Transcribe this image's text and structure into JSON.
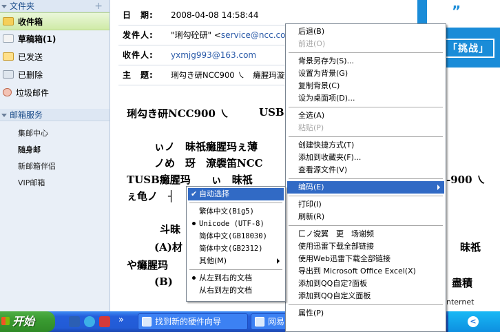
{
  "sidebar": {
    "folders_header": "文件夹",
    "add_symbol": "+",
    "folders": [
      {
        "label": "收件箱",
        "icon": "inbox-icon"
      },
      {
        "label": "草稿箱(1)",
        "icon": "draft-icon"
      },
      {
        "label": "已发送",
        "icon": "sent-icon"
      },
      {
        "label": "已删除",
        "icon": "deleted-icon"
      },
      {
        "label": "垃圾邮件",
        "icon": "trash-icon"
      }
    ],
    "services_header": "邮箱服务",
    "services": [
      "集邮中心",
      "随身邮",
      "新邮箱伴侣",
      "VIP邮箱"
    ]
  },
  "header": {
    "date_label": "日　期:",
    "date_value": "2008-04-08 14:58:44",
    "from_label": "发件人:",
    "from_name": "\"琍勾砼研\" <",
    "from_email": "service@ncc.co",
    "to_label": "收件人:",
    "to_value": "yxmjg993@163.com",
    "subject_label": "主　题:",
    "subject_value": "琍勾き研NCC900 ㇏　癱腥玛漩"
  },
  "banner": {
    "quote": "”",
    "tag": "「挑战」"
  },
  "body": {
    "line1a": "琍勾き研NCC900 ㇏",
    "line1b": "USB",
    "line2": "ぃノ　昧祇癱腥玛ぇ薄",
    "line3": "ノめ　玡　潦褜笛NCC",
    "line4a": "TUSB癱腥玛　　ぃ　昧祇",
    "line4b": "-900 ㇏",
    "line5": "ぇ龟ノ　┤",
    "line6": "斗昧",
    "line7a": "(A)材",
    "line7b": "昧祇",
    "line8": "や癱腥玛",
    "line9a": "(B)",
    "line9b": "盡積"
  },
  "context_menu": {
    "items": [
      {
        "label": "后退(B)",
        "disabled": false
      },
      {
        "label": "前进(O)",
        "disabled": true
      },
      {
        "sep": true
      },
      {
        "label": "背景另存为(S)...",
        "disabled": false
      },
      {
        "label": "设置为背景(G)",
        "disabled": false
      },
      {
        "label": "复制背景(C)",
        "disabled": false
      },
      {
        "label": "设为桌面项(D)...",
        "disabled": false
      },
      {
        "sep": true
      },
      {
        "label": "全选(A)",
        "disabled": false
      },
      {
        "label": "粘贴(P)",
        "disabled": true
      },
      {
        "sep": true
      },
      {
        "label": "创建快捷方式(T)",
        "disabled": false
      },
      {
        "label": "添加到收藏夹(F)...",
        "disabled": false
      },
      {
        "label": "查看源文件(V)",
        "disabled": false
      },
      {
        "sep": true
      },
      {
        "label": "编码(E)",
        "disabled": false,
        "highlighted": true,
        "submenu": true
      },
      {
        "sep": true
      },
      {
        "label": "打印(I)",
        "disabled": false
      },
      {
        "label": "刷新(R)",
        "disabled": false
      },
      {
        "sep": true
      },
      {
        "label": "匚ノ谠翼　更　场谢频",
        "disabled": false
      },
      {
        "label": "使用迅雷下载全部链接",
        "disabled": false
      },
      {
        "label": "使用Web迅雷下载全部链接",
        "disabled": false
      },
      {
        "label": "导出到 Microsoft Office Excel(X)",
        "disabled": false
      },
      {
        "label": "添加到QQ自定?面板",
        "disabled": false
      },
      {
        "label": "添加到QQ自定义面板",
        "disabled": false
      },
      {
        "sep": true
      },
      {
        "label": "属性(P)",
        "disabled": false
      }
    ]
  },
  "encoding_submenu": {
    "items": [
      {
        "label": "自动选择",
        "mark": "check",
        "highlighted": true
      },
      {
        "sep": true
      },
      {
        "label": "繁体中文(Big5)",
        "mark": ""
      },
      {
        "label": "Unicode (UTF-8)",
        "mark": "dot"
      },
      {
        "label": "简体中文(GB18030)",
        "mark": ""
      },
      {
        "label": "简体中文(GB2312)",
        "mark": ""
      },
      {
        "label": "其他(M)",
        "mark": "",
        "submenu": true
      },
      {
        "sep": true
      },
      {
        "label": "从左到右的文档",
        "mark": "dot"
      },
      {
        "label": "从右到左的文档",
        "mark": ""
      }
    ]
  },
  "status": {
    "zone": "nternet"
  },
  "taskbar": {
    "start_label": "开始",
    "quicklaunch": [
      "word-icon",
      "ie-icon",
      "media-icon"
    ],
    "more": "»",
    "buttons": [
      {
        "label": "找到新的硬件向导"
      },
      {
        "label": "网易"
      }
    ],
    "tray_icon_label": "<"
  },
  "colors": {
    "menu_highlight": "#316ac5",
    "taskbar_blue": "#245edb",
    "start_green": "#3a9b31",
    "sidebar_bg": "#e9eff7",
    "selected_folder": "#cfeaa7",
    "link_blue": "#2a5aa8"
  }
}
